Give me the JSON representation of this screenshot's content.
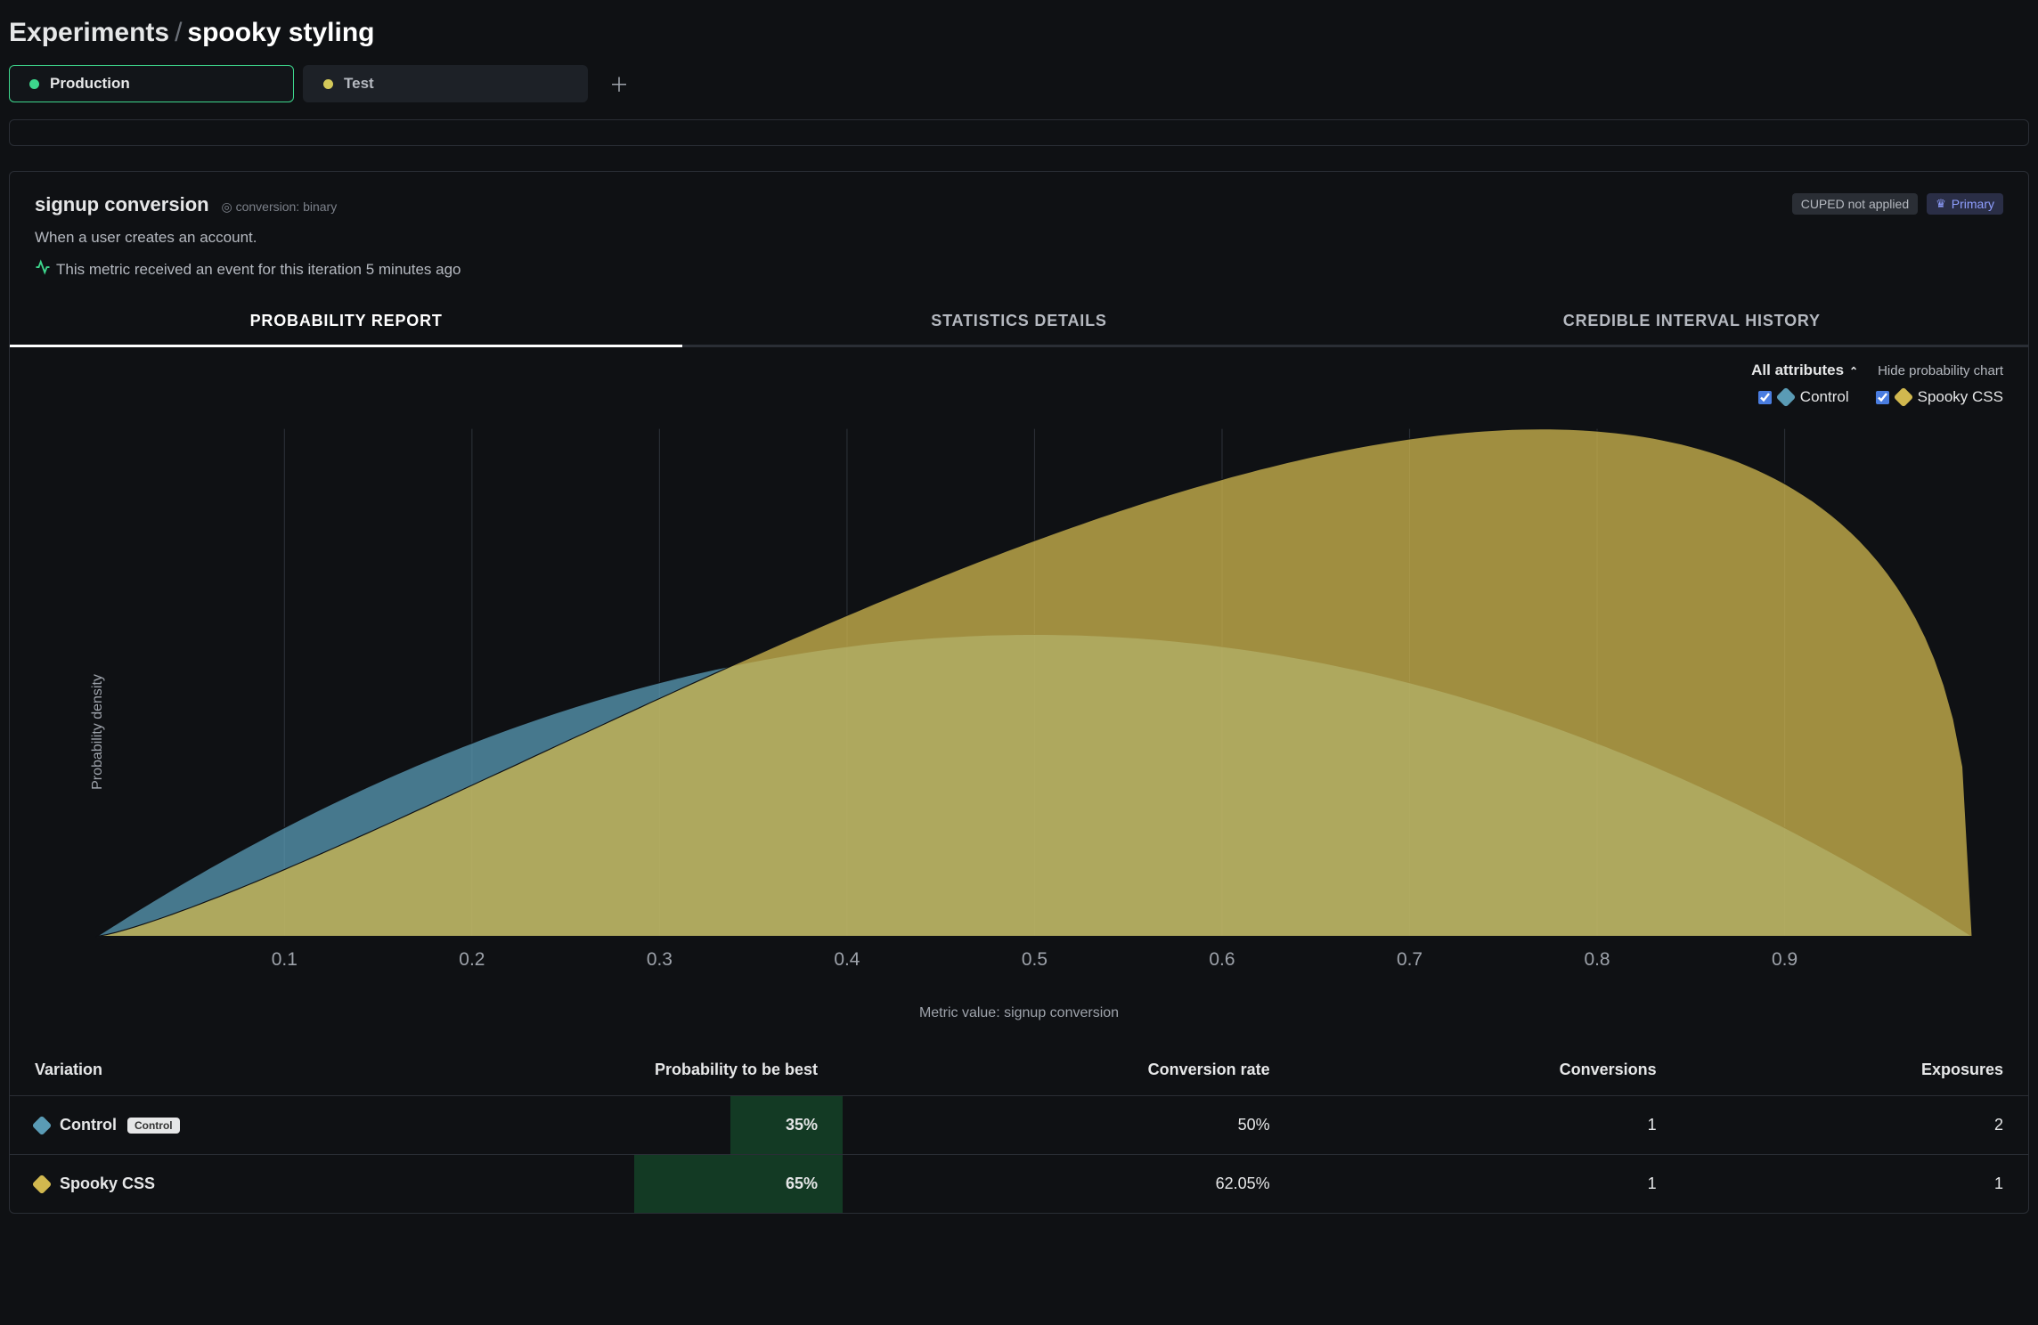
{
  "breadcrumb": {
    "parent": "Experiments",
    "current": "spooky styling"
  },
  "envs": {
    "production": "Production",
    "test": "Test"
  },
  "metric": {
    "title": "signup conversion",
    "type": "conversion: binary",
    "description": "When a user creates an account.",
    "status": "This metric received an event for this iteration 5 minutes ago"
  },
  "badges": {
    "cuped": "CUPED not applied",
    "primary": "Primary"
  },
  "tabs": {
    "prob": "PROBABILITY REPORT",
    "stats": "STATISTICS DETAILS",
    "history": "CREDIBLE INTERVAL HISTORY"
  },
  "controls": {
    "attributes": "All attributes",
    "hide": "Hide probability chart"
  },
  "legend": {
    "control": "Control",
    "spooky": "Spooky CSS"
  },
  "chart_data": {
    "type": "area",
    "title": "",
    "xlabel": "Metric value: signup conversion",
    "ylabel": "Probability density",
    "xlim": [
      0,
      1
    ],
    "x_ticks": [
      0.1,
      0.2,
      0.3,
      0.4,
      0.5,
      0.6,
      0.7,
      0.8,
      0.9
    ],
    "series": [
      {
        "name": "Control",
        "color": "#5a9bb5",
        "dist": "beta",
        "alpha": 2,
        "beta": 2
      },
      {
        "name": "Spooky CSS",
        "color": "#d1b84f",
        "dist": "beta",
        "alpha": 2.2405,
        "beta": 1.3695
      }
    ]
  },
  "table": {
    "headers": {
      "variation": "Variation",
      "prob": "Probability to be best",
      "conv_rate": "Conversion rate",
      "conversions": "Conversions",
      "exposures": "Exposures"
    },
    "rows": [
      {
        "name": "Control",
        "is_control": true,
        "control_label": "Control",
        "prob": "35%",
        "prob_width": 35,
        "rate": "50%",
        "conversions": "1",
        "exposures": "2"
      },
      {
        "name": "Spooky CSS",
        "is_control": false,
        "control_label": "",
        "prob": "65%",
        "prob_width": 65,
        "rate": "62.05%",
        "conversions": "1",
        "exposures": "1"
      }
    ]
  }
}
